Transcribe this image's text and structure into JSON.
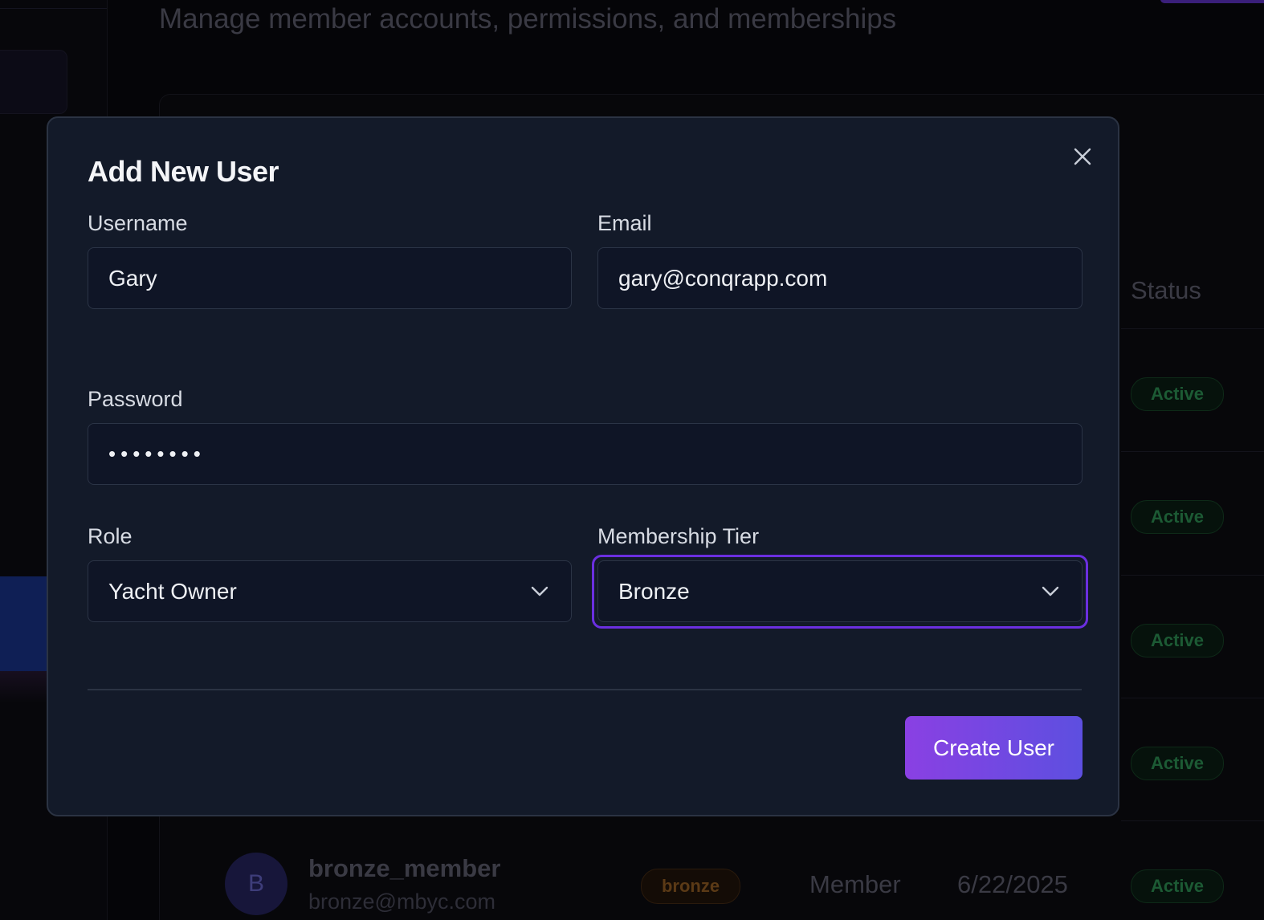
{
  "background": {
    "subtitle": "Manage member accounts, permissions, and memberships",
    "table": {
      "status_header": "Status",
      "status_badges": [
        "Active",
        "Active",
        "Active",
        "Active",
        "Active"
      ],
      "last_row": {
        "avatar_initial": "B",
        "username": "bronze_member",
        "email": "bronze@mbyc.com",
        "tier": "bronze",
        "role": "Member",
        "date": "6/22/2025",
        "status": "Active"
      }
    }
  },
  "modal": {
    "title": "Add New User",
    "close_icon": "close-icon",
    "fields": {
      "username": {
        "label": "Username",
        "value": "Gary"
      },
      "email": {
        "label": "Email",
        "value": "gary@conqrapp.com"
      },
      "password": {
        "label": "Password",
        "value": "••••••••"
      },
      "role": {
        "label": "Role",
        "value": "Yacht Owner"
      },
      "tier": {
        "label": "Membership Tier",
        "value": "Bronze"
      }
    },
    "submit_label": "Create User"
  },
  "colors": {
    "modal_bg": "#131a29",
    "focus_ring": "#6b2fe0",
    "button_gradient_start": "#8a40e3",
    "button_gradient_end": "#5d4fe0"
  }
}
